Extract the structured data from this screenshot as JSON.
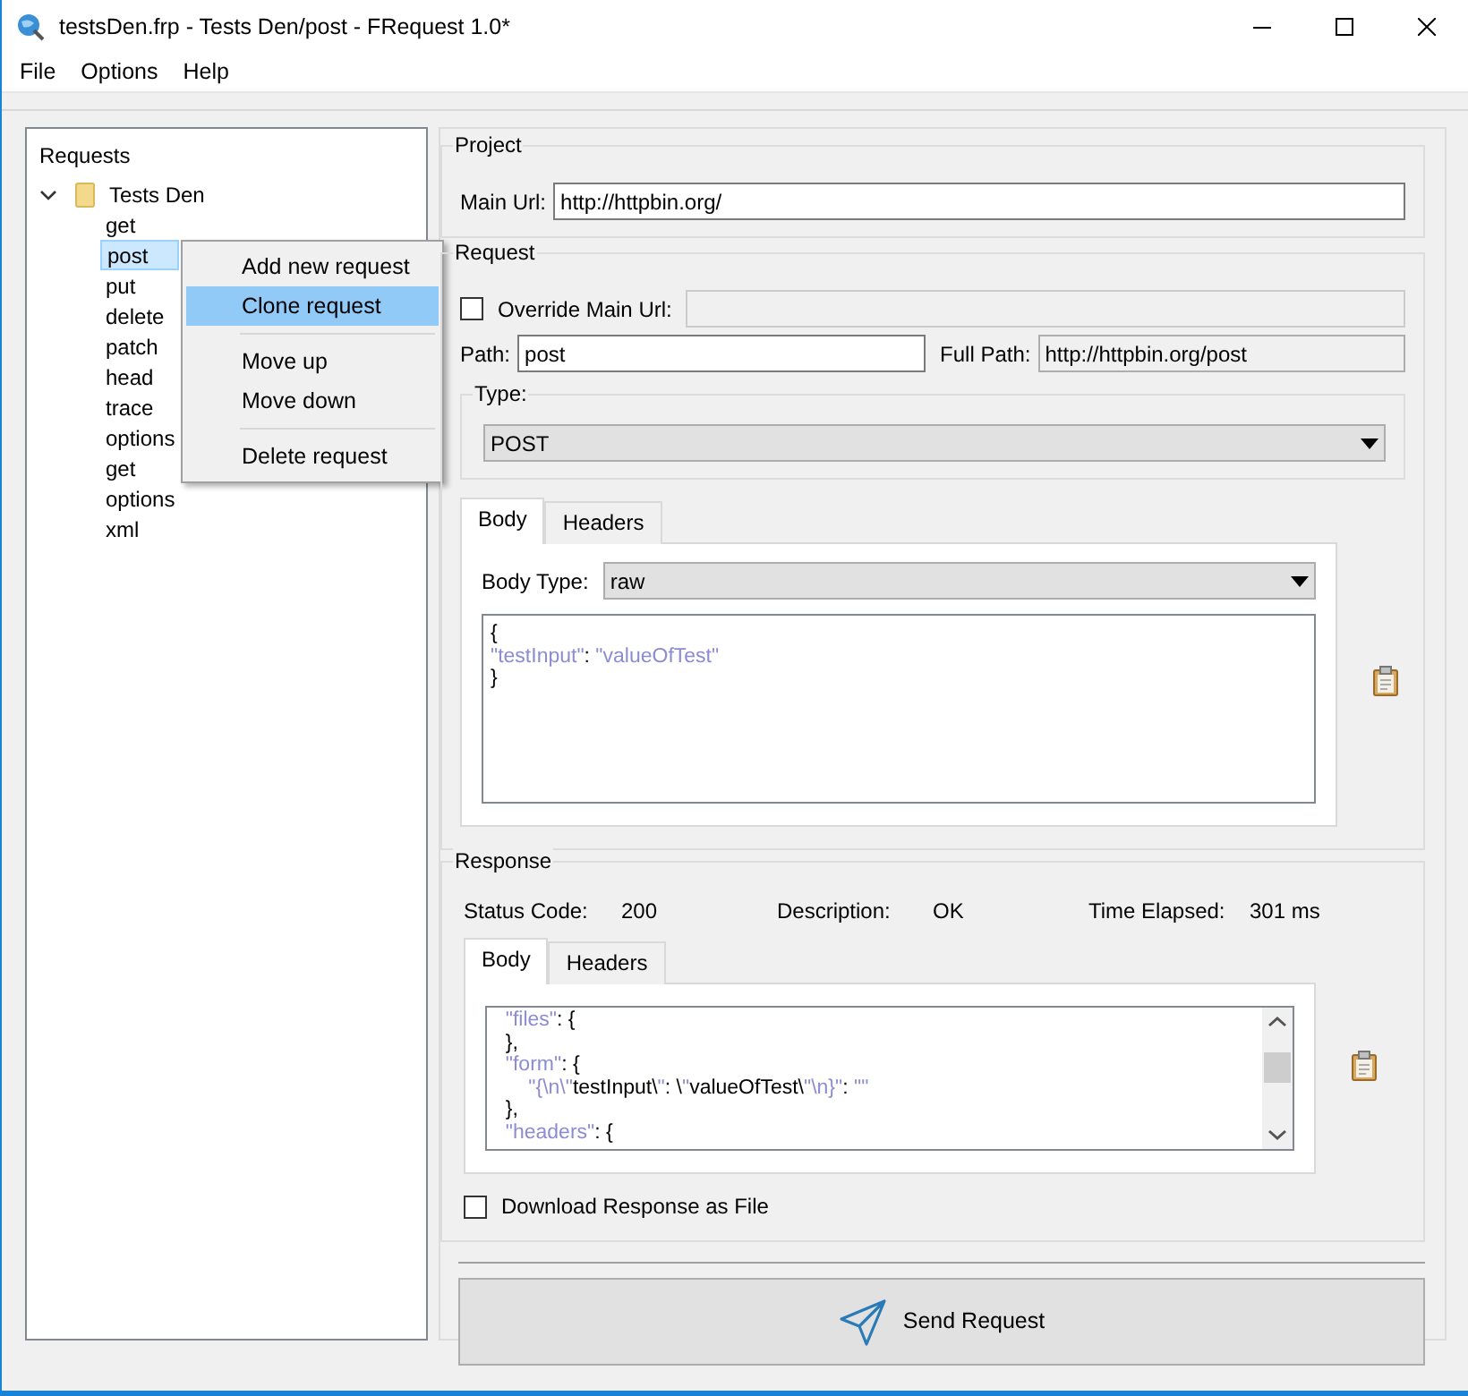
{
  "window": {
    "title": "testsDen.frp - Tests Den/post - FRequest 1.0*"
  },
  "menu": [
    "File",
    "Options",
    "Help"
  ],
  "requests_tree": {
    "header": "Requests",
    "items": [
      {
        "label": "Tests Den",
        "expanded": true,
        "children": [
          {
            "label": "get",
            "selected": false
          },
          {
            "label": "post",
            "selected": true
          },
          {
            "label": "put",
            "selected": false
          },
          {
            "label": "delete",
            "selected": false
          },
          {
            "label": "patch",
            "selected": false
          },
          {
            "label": "head",
            "selected": false
          },
          {
            "label": "trace",
            "selected": false
          },
          {
            "label": "options",
            "selected": false
          },
          {
            "label": "get",
            "selected": false
          },
          {
            "label": "options",
            "selected": false
          },
          {
            "label": "xml",
            "selected": false
          }
        ]
      }
    ]
  },
  "context_menu": {
    "items": [
      {
        "kind": "item",
        "label": "Add new request",
        "selected": false
      },
      {
        "kind": "item",
        "label": "Clone request",
        "selected": true
      },
      {
        "kind": "separator"
      },
      {
        "kind": "item",
        "label": "Move up",
        "selected": false
      },
      {
        "kind": "item",
        "label": "Move down",
        "selected": false
      },
      {
        "kind": "separator"
      },
      {
        "kind": "item",
        "label": "Delete request",
        "selected": false
      }
    ]
  },
  "project": {
    "title": "Project",
    "main_url_label": "Main Url:",
    "main_url": "http://httpbin.org/"
  },
  "request": {
    "title": "Request",
    "override_label": "Override Main Url:",
    "override_checked": false,
    "path_label": "Path:",
    "path": "post",
    "full_path_label": "Full Path:",
    "full_path": "http://httpbin.org/post",
    "type_title": "Type:",
    "type_value": "POST",
    "tabs": [
      {
        "label": "Body",
        "selected": true
      },
      {
        "label": "Headers",
        "selected": false
      }
    ],
    "body_type_label": "Body Type:",
    "body_type": "raw",
    "body_lines": [
      [
        {
          "t": "{",
          "kind": "punct"
        }
      ],
      [
        {
          "t": "\"testInput\"",
          "kind": "string"
        },
        {
          "t": ": ",
          "kind": "punct"
        },
        {
          "t": "\"valueOfTest\"",
          "kind": "string"
        }
      ],
      [
        {
          "t": "}",
          "kind": "punct"
        }
      ]
    ]
  },
  "response": {
    "title": "Response",
    "status_code_label": "Status Code:",
    "status_code": "200",
    "description_label": "Description:",
    "description": "OK",
    "time_label": "Time Elapsed:",
    "time": "301 ms",
    "tabs": [
      {
        "label": "Body",
        "selected": true
      },
      {
        "label": "Headers",
        "selected": false
      }
    ],
    "body_lines": [
      [
        {
          "t": "  \"files\"",
          "kind": "string"
        },
        {
          "t": ": {",
          "kind": "punct"
        }
      ],
      [
        {
          "t": "  },",
          "kind": "punct"
        }
      ],
      [
        {
          "t": "  \"form\"",
          "kind": "string"
        },
        {
          "t": ": {",
          "kind": "punct"
        }
      ],
      [
        {
          "t": "      \"{\\n\\\"",
          "kind": "string"
        },
        {
          "t": "testInput\\",
          "kind": "punct"
        },
        {
          "t": "\"",
          "kind": "string"
        },
        {
          "t": ": \\",
          "kind": "punct"
        },
        {
          "t": "\"",
          "kind": "string"
        },
        {
          "t": "valueOfTest\\",
          "kind": "punct"
        },
        {
          "t": "\"\\n}\"",
          "kind": "string"
        },
        {
          "t": ": ",
          "kind": "punct"
        },
        {
          "t": "\"\"",
          "kind": "string"
        }
      ],
      [
        {
          "t": "  },",
          "kind": "punct"
        }
      ],
      [
        {
          "t": "  \"headers\"",
          "kind": "string"
        },
        {
          "t": ": {",
          "kind": "punct"
        }
      ]
    ],
    "download_label": "Download Response as File",
    "download_checked": false
  },
  "send_button": {
    "label": "Send Request"
  }
}
